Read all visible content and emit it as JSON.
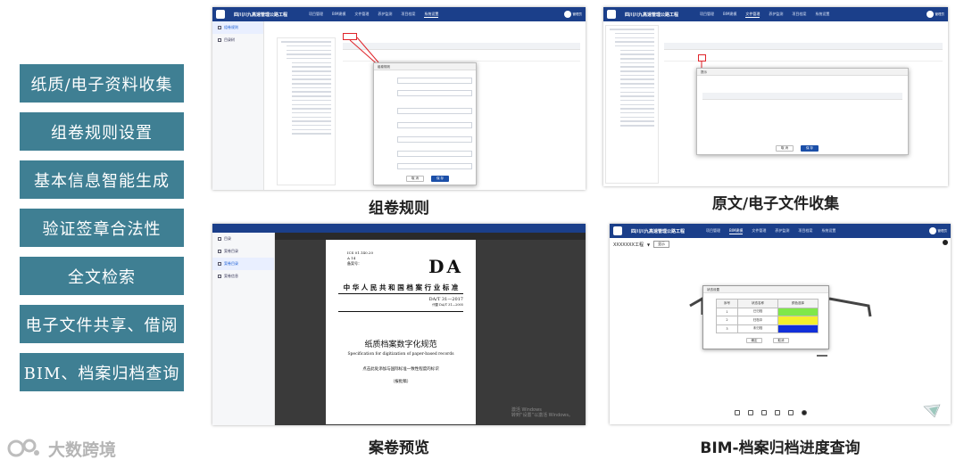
{
  "features": [
    "纸质/电子资料收集",
    "组卷规则设置",
    "基本信息智能生成",
    "验证签章合法性",
    "全文检索",
    "电子文件共享、借阅",
    "BIM、档案归档查询"
  ],
  "logo": {
    "text": "大数跨境"
  },
  "captions": {
    "p1": "组卷规则",
    "p2": "原文/电子文件收集",
    "p3": "案卷预览",
    "p4": "BIM-档案归档进度查询"
  },
  "app": {
    "title": "四川川九高速管理公路工程",
    "nav": [
      "项目管理",
      "BIM建模",
      "文件管理",
      "养护监测",
      "项目档案",
      "系统设置"
    ],
    "user": "管理员"
  },
  "p1": {
    "side": [
      "组卷规则",
      "目录树"
    ],
    "dialog_title": "组卷规则",
    "buttons": {
      "cancel": "取 消",
      "ok": "保 存"
    }
  },
  "p2": {
    "dialog_title": "提示",
    "buttons": {
      "cancel": "取 消",
      "ok": "保 存"
    }
  },
  "p3": {
    "side": [
      "目录",
      "案卷目录",
      "案卷目录",
      "案卷信息"
    ],
    "doc": {
      "ics": "ICS 01.140.20",
      "ccs": "A 14",
      "record": "备案号：",
      "da": "DA",
      "header": "中 华 人 民 共 和 国 档 案 行 业 标 准",
      "code": "DA/T 31—2017",
      "replaces": "代替 DA/T 31—2005",
      "title_cn": "纸质档案数字化规范",
      "title_en": "Specification for digitization of paper-based records",
      "note": "点击此处添加与国际标准一致性程度的标识",
      "status": "（报批稿）"
    },
    "watermark": [
      "激活 Windows",
      "转到“设置”以激活 Windows。"
    ]
  },
  "p4": {
    "dropdown": "XXXXXXX工程",
    "dropdown_btn": "显示",
    "dialog_title": "状态设置",
    "table": {
      "headers": [
        "序号",
        "状态名称",
        "颜色选择"
      ],
      "rows": [
        {
          "no": "1",
          "name": "已归档",
          "color": "#7fe84a"
        },
        {
          "no": "2",
          "name": "归档中",
          "color": "#f4f02c"
        },
        {
          "no": "3",
          "name": "未归档",
          "color": "#1230d9"
        }
      ]
    },
    "buttons": {
      "ok": "确定",
      "cancel": "取消"
    }
  }
}
